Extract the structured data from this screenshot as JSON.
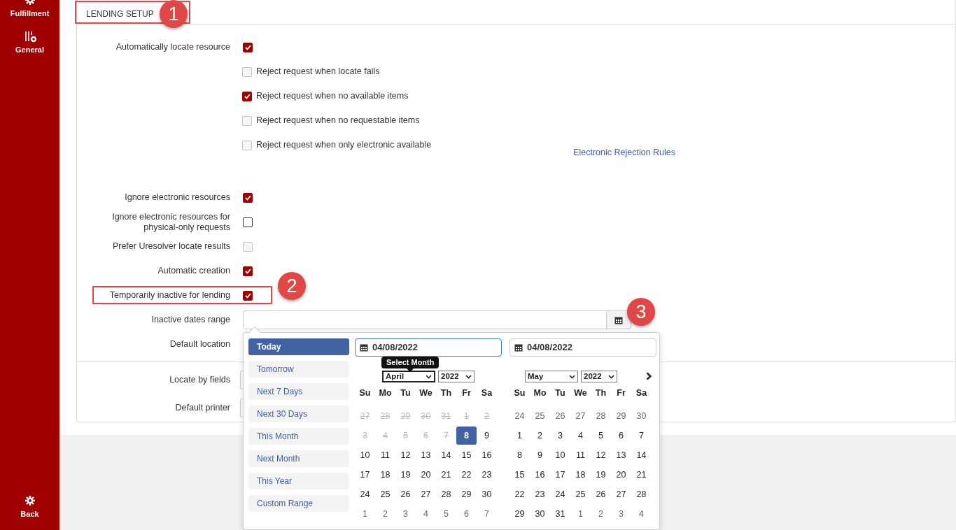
{
  "sidebar": {
    "items": [
      {
        "label": "Fulfillment",
        "selected": false
      },
      {
        "label": "General",
        "selected": false
      }
    ],
    "back": "Back"
  },
  "section_tab": "LENDING SETUP",
  "locate": {
    "label": "Automatically locate resource",
    "checked": true,
    "options": [
      {
        "label": "Reject request when locate fails",
        "checked": false,
        "disabled": true
      },
      {
        "label": "Reject request when no available items",
        "checked": true,
        "disabled": false
      },
      {
        "label": "Reject request when no requestable items",
        "checked": false,
        "disabled": true
      },
      {
        "label": "Reject request when only electronic available",
        "checked": false,
        "disabled": true
      }
    ],
    "link": "Electronic Rejection Rules"
  },
  "settings": [
    {
      "kind": "checkbox",
      "label": "Ignore electronic resources",
      "checked": true,
      "disabled": false
    },
    {
      "kind": "checkbox",
      "label": "Ignore electronic resources for physical-only requests",
      "checked": false,
      "disabled": false
    },
    {
      "kind": "checkbox",
      "label": "Prefer Uresolver locate results",
      "checked": false,
      "disabled": true
    },
    {
      "kind": "checkbox",
      "label": "Automatic creation",
      "checked": true,
      "disabled": false
    },
    {
      "kind": "checkbox",
      "label": "Temporarily inactive for lending",
      "checked": true,
      "disabled": false,
      "highlighted": true
    },
    {
      "kind": "daterange",
      "label": "Inactive dates range"
    },
    {
      "kind": "select",
      "label": "Default location"
    }
  ],
  "settings_2": [
    {
      "label": "Locate by fields"
    },
    {
      "label": "Default printer"
    }
  ],
  "callouts": [
    "1",
    "2",
    "3"
  ],
  "date_picker": {
    "ranges": [
      {
        "label": "Today",
        "selected": true
      },
      {
        "label": "Tomorrow",
        "selected": false
      },
      {
        "label": "Next 7 Days",
        "selected": false
      },
      {
        "label": "Next 30 Days",
        "selected": false
      },
      {
        "label": "This Month",
        "selected": false
      },
      {
        "label": "Next Month",
        "selected": false
      },
      {
        "label": "This Year",
        "selected": false
      },
      {
        "label": "Custom Range",
        "selected": false
      }
    ],
    "start_date": "04/08/2022",
    "end_date": "04/08/2022",
    "tooltip": "Select Month",
    "calendars": [
      {
        "month": "April",
        "year": "2022",
        "weekdays": [
          "Su",
          "Mo",
          "Tu",
          "We",
          "Th",
          "Fr",
          "Sa"
        ],
        "days": [
          {
            "text": "27",
            "kind": "past",
            "selected": false
          },
          {
            "text": "28",
            "kind": "past",
            "selected": false
          },
          {
            "text": "29",
            "kind": "past",
            "selected": false
          },
          {
            "text": "30",
            "kind": "past",
            "selected": false
          },
          {
            "text": "31",
            "kind": "past",
            "selected": false
          },
          {
            "text": "1",
            "kind": "past",
            "selected": false
          },
          {
            "text": "2",
            "kind": "past",
            "selected": false
          },
          {
            "text": "3",
            "kind": "past",
            "selected": false
          },
          {
            "text": "4",
            "kind": "past",
            "selected": false
          },
          {
            "text": "5",
            "kind": "past",
            "selected": false
          },
          {
            "text": "6",
            "kind": "past",
            "selected": false
          },
          {
            "text": "7",
            "kind": "past",
            "selected": false
          },
          {
            "text": "8",
            "kind": "normal",
            "selected": true
          },
          {
            "text": "9",
            "kind": "normal",
            "selected": false
          },
          {
            "text": "10",
            "kind": "normal",
            "selected": false
          },
          {
            "text": "11",
            "kind": "normal",
            "selected": false
          },
          {
            "text": "12",
            "kind": "normal",
            "selected": false
          },
          {
            "text": "13",
            "kind": "normal",
            "selected": false
          },
          {
            "text": "14",
            "kind": "normal",
            "selected": false
          },
          {
            "text": "15",
            "kind": "normal",
            "selected": false
          },
          {
            "text": "16",
            "kind": "normal",
            "selected": false
          },
          {
            "text": "17",
            "kind": "normal",
            "selected": false
          },
          {
            "text": "18",
            "kind": "normal",
            "selected": false
          },
          {
            "text": "19",
            "kind": "normal",
            "selected": false
          },
          {
            "text": "20",
            "kind": "normal",
            "selected": false
          },
          {
            "text": "21",
            "kind": "normal",
            "selected": false
          },
          {
            "text": "22",
            "kind": "normal",
            "selected": false
          },
          {
            "text": "23",
            "kind": "normal",
            "selected": false
          },
          {
            "text": "24",
            "kind": "normal",
            "selected": false
          },
          {
            "text": "25",
            "kind": "normal",
            "selected": false
          },
          {
            "text": "26",
            "kind": "normal",
            "selected": false
          },
          {
            "text": "27",
            "kind": "normal",
            "selected": false
          },
          {
            "text": "28",
            "kind": "normal",
            "selected": false
          },
          {
            "text": "29",
            "kind": "normal",
            "selected": false
          },
          {
            "text": "30",
            "kind": "normal",
            "selected": false
          },
          {
            "text": "1",
            "kind": "other",
            "selected": false
          },
          {
            "text": "2",
            "kind": "other",
            "selected": false
          },
          {
            "text": "3",
            "kind": "other",
            "selected": false
          },
          {
            "text": "4",
            "kind": "other",
            "selected": false
          },
          {
            "text": "5",
            "kind": "other",
            "selected": false
          },
          {
            "text": "6",
            "kind": "other",
            "selected": false
          },
          {
            "text": "7",
            "kind": "other",
            "selected": false
          }
        ]
      },
      {
        "month": "May",
        "year": "2022",
        "weekdays": [
          "Su",
          "Mo",
          "Tu",
          "We",
          "Th",
          "Fr",
          "Sa"
        ],
        "days": [
          {
            "text": "24",
            "kind": "other",
            "selected": false
          },
          {
            "text": "25",
            "kind": "other",
            "selected": false
          },
          {
            "text": "26",
            "kind": "other",
            "selected": false
          },
          {
            "text": "27",
            "kind": "other",
            "selected": false
          },
          {
            "text": "28",
            "kind": "other",
            "selected": false
          },
          {
            "text": "29",
            "kind": "other",
            "selected": false
          },
          {
            "text": "30",
            "kind": "other",
            "selected": false
          },
          {
            "text": "1",
            "kind": "normal",
            "selected": false
          },
          {
            "text": "2",
            "kind": "normal",
            "selected": false
          },
          {
            "text": "3",
            "kind": "normal",
            "selected": false
          },
          {
            "text": "4",
            "kind": "normal",
            "selected": false
          },
          {
            "text": "5",
            "kind": "normal",
            "selected": false
          },
          {
            "text": "6",
            "kind": "normal",
            "selected": false
          },
          {
            "text": "7",
            "kind": "normal",
            "selected": false
          },
          {
            "text": "8",
            "kind": "normal",
            "selected": false
          },
          {
            "text": "9",
            "kind": "normal",
            "selected": false
          },
          {
            "text": "10",
            "kind": "normal",
            "selected": false
          },
          {
            "text": "11",
            "kind": "normal",
            "selected": false
          },
          {
            "text": "12",
            "kind": "normal",
            "selected": false
          },
          {
            "text": "13",
            "kind": "normal",
            "selected": false
          },
          {
            "text": "14",
            "kind": "normal",
            "selected": false
          },
          {
            "text": "15",
            "kind": "normal",
            "selected": false
          },
          {
            "text": "16",
            "kind": "normal",
            "selected": false
          },
          {
            "text": "17",
            "kind": "normal",
            "selected": false
          },
          {
            "text": "18",
            "kind": "normal",
            "selected": false
          },
          {
            "text": "19",
            "kind": "normal",
            "selected": false
          },
          {
            "text": "20",
            "kind": "normal",
            "selected": false
          },
          {
            "text": "21",
            "kind": "normal",
            "selected": false
          },
          {
            "text": "22",
            "kind": "normal",
            "selected": false
          },
          {
            "text": "23",
            "kind": "normal",
            "selected": false
          },
          {
            "text": "24",
            "kind": "normal",
            "selected": false
          },
          {
            "text": "25",
            "kind": "normal",
            "selected": false
          },
          {
            "text": "26",
            "kind": "normal",
            "selected": false
          },
          {
            "text": "27",
            "kind": "normal",
            "selected": false
          },
          {
            "text": "28",
            "kind": "normal",
            "selected": false
          },
          {
            "text": "29",
            "kind": "normal",
            "selected": false
          },
          {
            "text": "30",
            "kind": "normal",
            "selected": false
          },
          {
            "text": "31",
            "kind": "normal",
            "selected": false
          },
          {
            "text": "1",
            "kind": "other",
            "selected": false
          },
          {
            "text": "2",
            "kind": "other",
            "selected": false
          },
          {
            "text": "3",
            "kind": "other",
            "selected": false
          },
          {
            "text": "4",
            "kind": "other",
            "selected": false
          }
        ]
      }
    ]
  }
}
